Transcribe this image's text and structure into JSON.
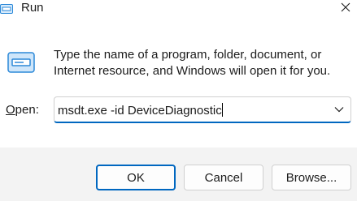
{
  "window": {
    "title": "Run",
    "icons": {
      "title": "run-app-icon",
      "close": "close-icon",
      "body": "run-app-icon-large",
      "dropdown": "chevron-down-icon"
    }
  },
  "main": {
    "description": "Type the name of a program, folder, document, or Internet resource, and Windows will open it for you.",
    "open_label_mnemonic": "O",
    "open_label_rest": "pen:",
    "command_value": "msdt.exe -id DeviceDiagnostic"
  },
  "buttons": {
    "ok": "OK",
    "cancel": "Cancel",
    "browse": "Browse..."
  },
  "colors": {
    "accent": "#0067c0",
    "footer_bg": "#f3f3f3",
    "icon_blue": "#2b88d8"
  }
}
